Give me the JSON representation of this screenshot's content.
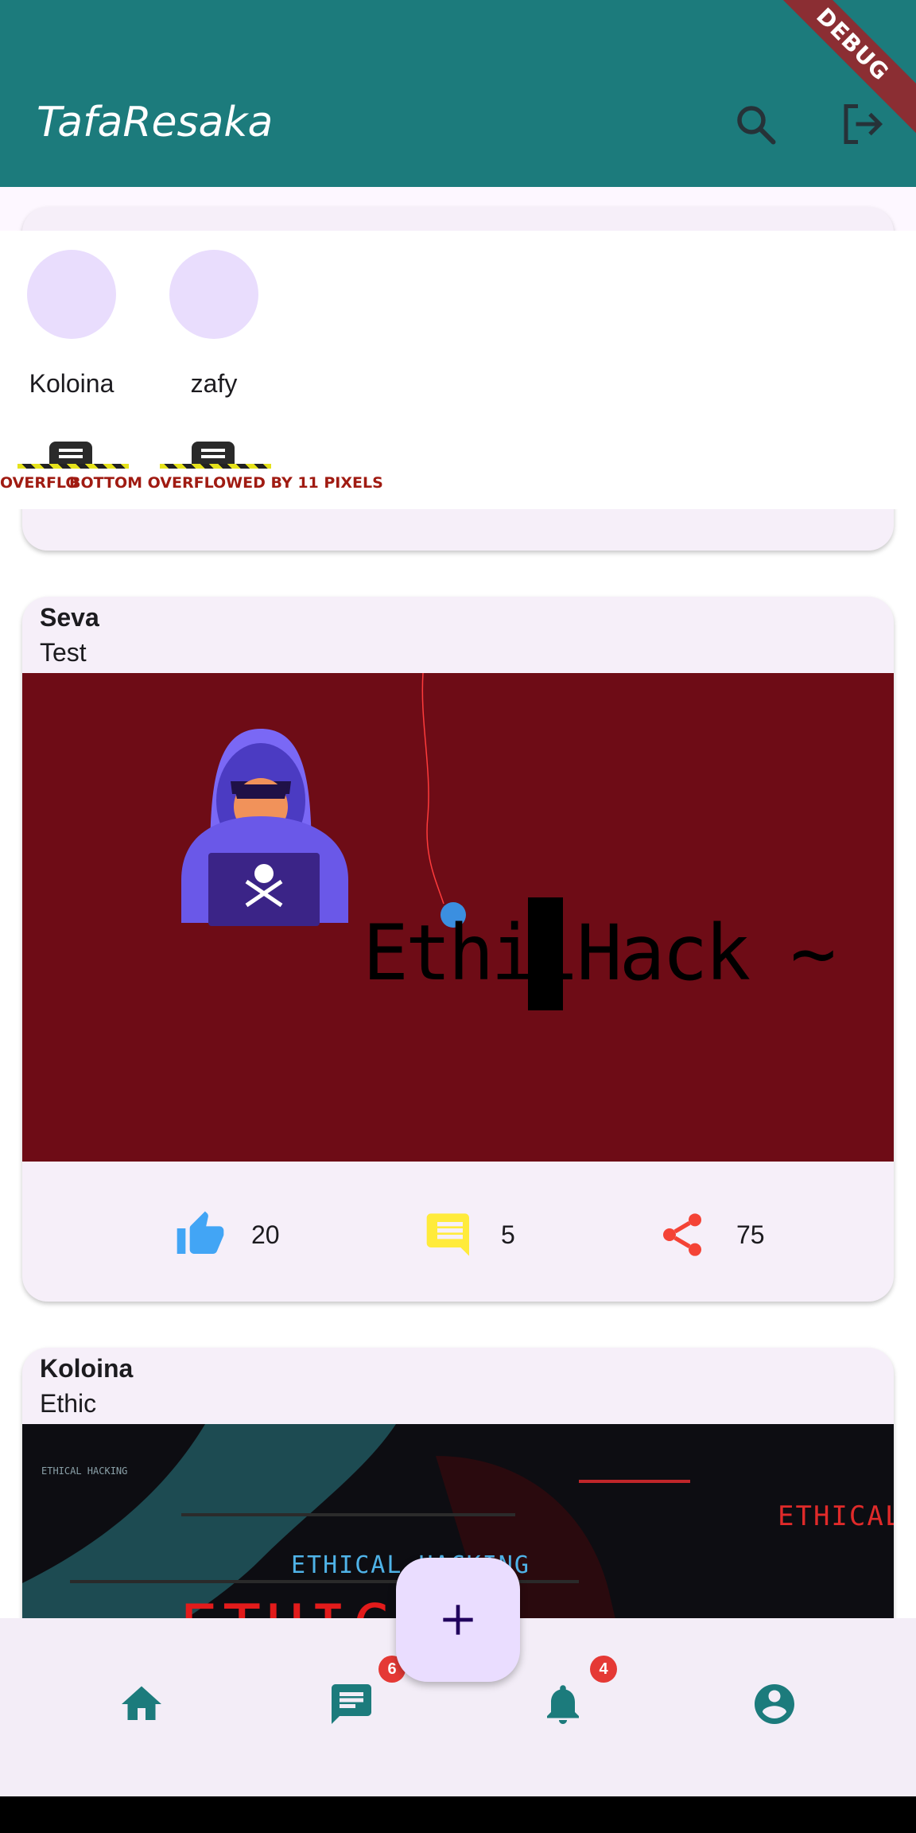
{
  "app": {
    "title": "TafaResaka",
    "debug_banner": "DEBUG"
  },
  "colors": {
    "app_bar": "#1c7b7c",
    "card_bg": "#f6eff9",
    "like": "#42a5f5",
    "comment": "#ffeb3b",
    "share": "#f44336",
    "nav_icon": "#1c7b7c",
    "badge": "#e53935",
    "fab_bg": "#eaddff"
  },
  "appbar_icons": [
    "search-icon",
    "logout-icon"
  ],
  "stories": [
    {
      "name": "Koloina"
    },
    {
      "name": "zafy"
    }
  ],
  "overflow_warnings": [
    "OVERFLO",
    "BOTTOM OVERFLOWED BY 11 PIXELS"
  ],
  "posts": [
    {
      "author": "Seva",
      "text": "Test",
      "image_caption": "EthilHack ~",
      "likes": "20",
      "comments": "5",
      "shares": "75"
    },
    {
      "author": "Koloina",
      "text": "Ethic",
      "image_texts": [
        "ETHICAL HACKING",
        "ETHICAL",
        "ETHIC",
        "ETHICAL HACKING"
      ]
    }
  ],
  "bottom_nav": {
    "items": [
      {
        "icon": "home-icon"
      },
      {
        "icon": "chat-icon",
        "badge": "6"
      },
      {
        "icon": "bell-icon",
        "badge": "4"
      },
      {
        "icon": "account-icon"
      }
    ],
    "fab_icon": "plus-icon"
  }
}
